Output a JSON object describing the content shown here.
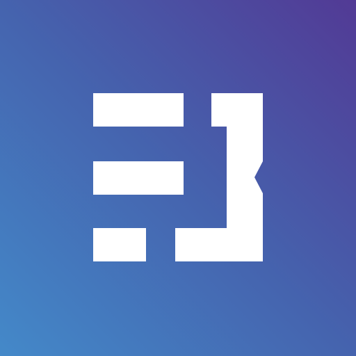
{
  "icon": {
    "name": "app-logo-icon",
    "gradient": {
      "start": "#4489c9",
      "middle": "#4563ae",
      "end": "#523a95"
    },
    "mark_color": "#ffffff"
  }
}
